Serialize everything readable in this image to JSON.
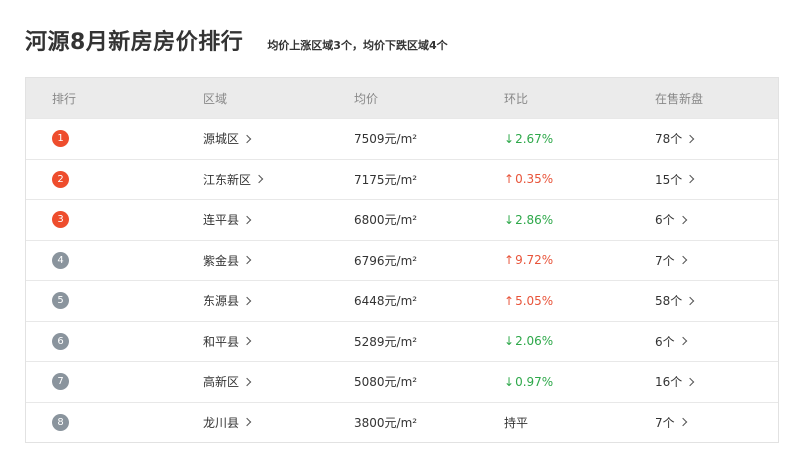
{
  "header": {
    "title": "河源8月新房房价排行",
    "subtitle": "均价上涨区域3个，均价下跌区域4个"
  },
  "colors": {
    "top_rank": "#ee4d2d",
    "other_rank": "#8a949d",
    "down": "#2ea84a",
    "up": "#e8543a"
  },
  "table": {
    "headers": [
      "排行",
      "区域",
      "均价",
      "环比",
      "在售新盘"
    ],
    "rows": [
      {
        "rank": "1",
        "area": "源城区",
        "price": "7509元/m²",
        "ratio_arrow": "↓",
        "ratio": "2.67%",
        "trend": "down",
        "count": "78个"
      },
      {
        "rank": "2",
        "area": "江东新区",
        "price": "7175元/m²",
        "ratio_arrow": "↑",
        "ratio": "0.35%",
        "trend": "up",
        "count": "15个"
      },
      {
        "rank": "3",
        "area": "连平县",
        "price": "6800元/m²",
        "ratio_arrow": "↓",
        "ratio": "2.86%",
        "trend": "down",
        "count": "6个"
      },
      {
        "rank": "4",
        "area": "紫金县",
        "price": "6796元/m²",
        "ratio_arrow": "↑",
        "ratio": "9.72%",
        "trend": "up",
        "count": "7个"
      },
      {
        "rank": "5",
        "area": "东源县",
        "price": "6448元/m²",
        "ratio_arrow": "↑",
        "ratio": "5.05%",
        "trend": "up",
        "count": "58个"
      },
      {
        "rank": "6",
        "area": "和平县",
        "price": "5289元/m²",
        "ratio_arrow": "↓",
        "ratio": "2.06%",
        "trend": "down",
        "count": "6个"
      },
      {
        "rank": "7",
        "area": "高新区",
        "price": "5080元/m²",
        "ratio_arrow": "↓",
        "ratio": "0.97%",
        "trend": "down",
        "count": "16个"
      },
      {
        "rank": "8",
        "area": "龙川县",
        "price": "3800元/m²",
        "ratio_arrow": "",
        "ratio": "持平",
        "trend": "flat",
        "count": "7个"
      }
    ]
  }
}
